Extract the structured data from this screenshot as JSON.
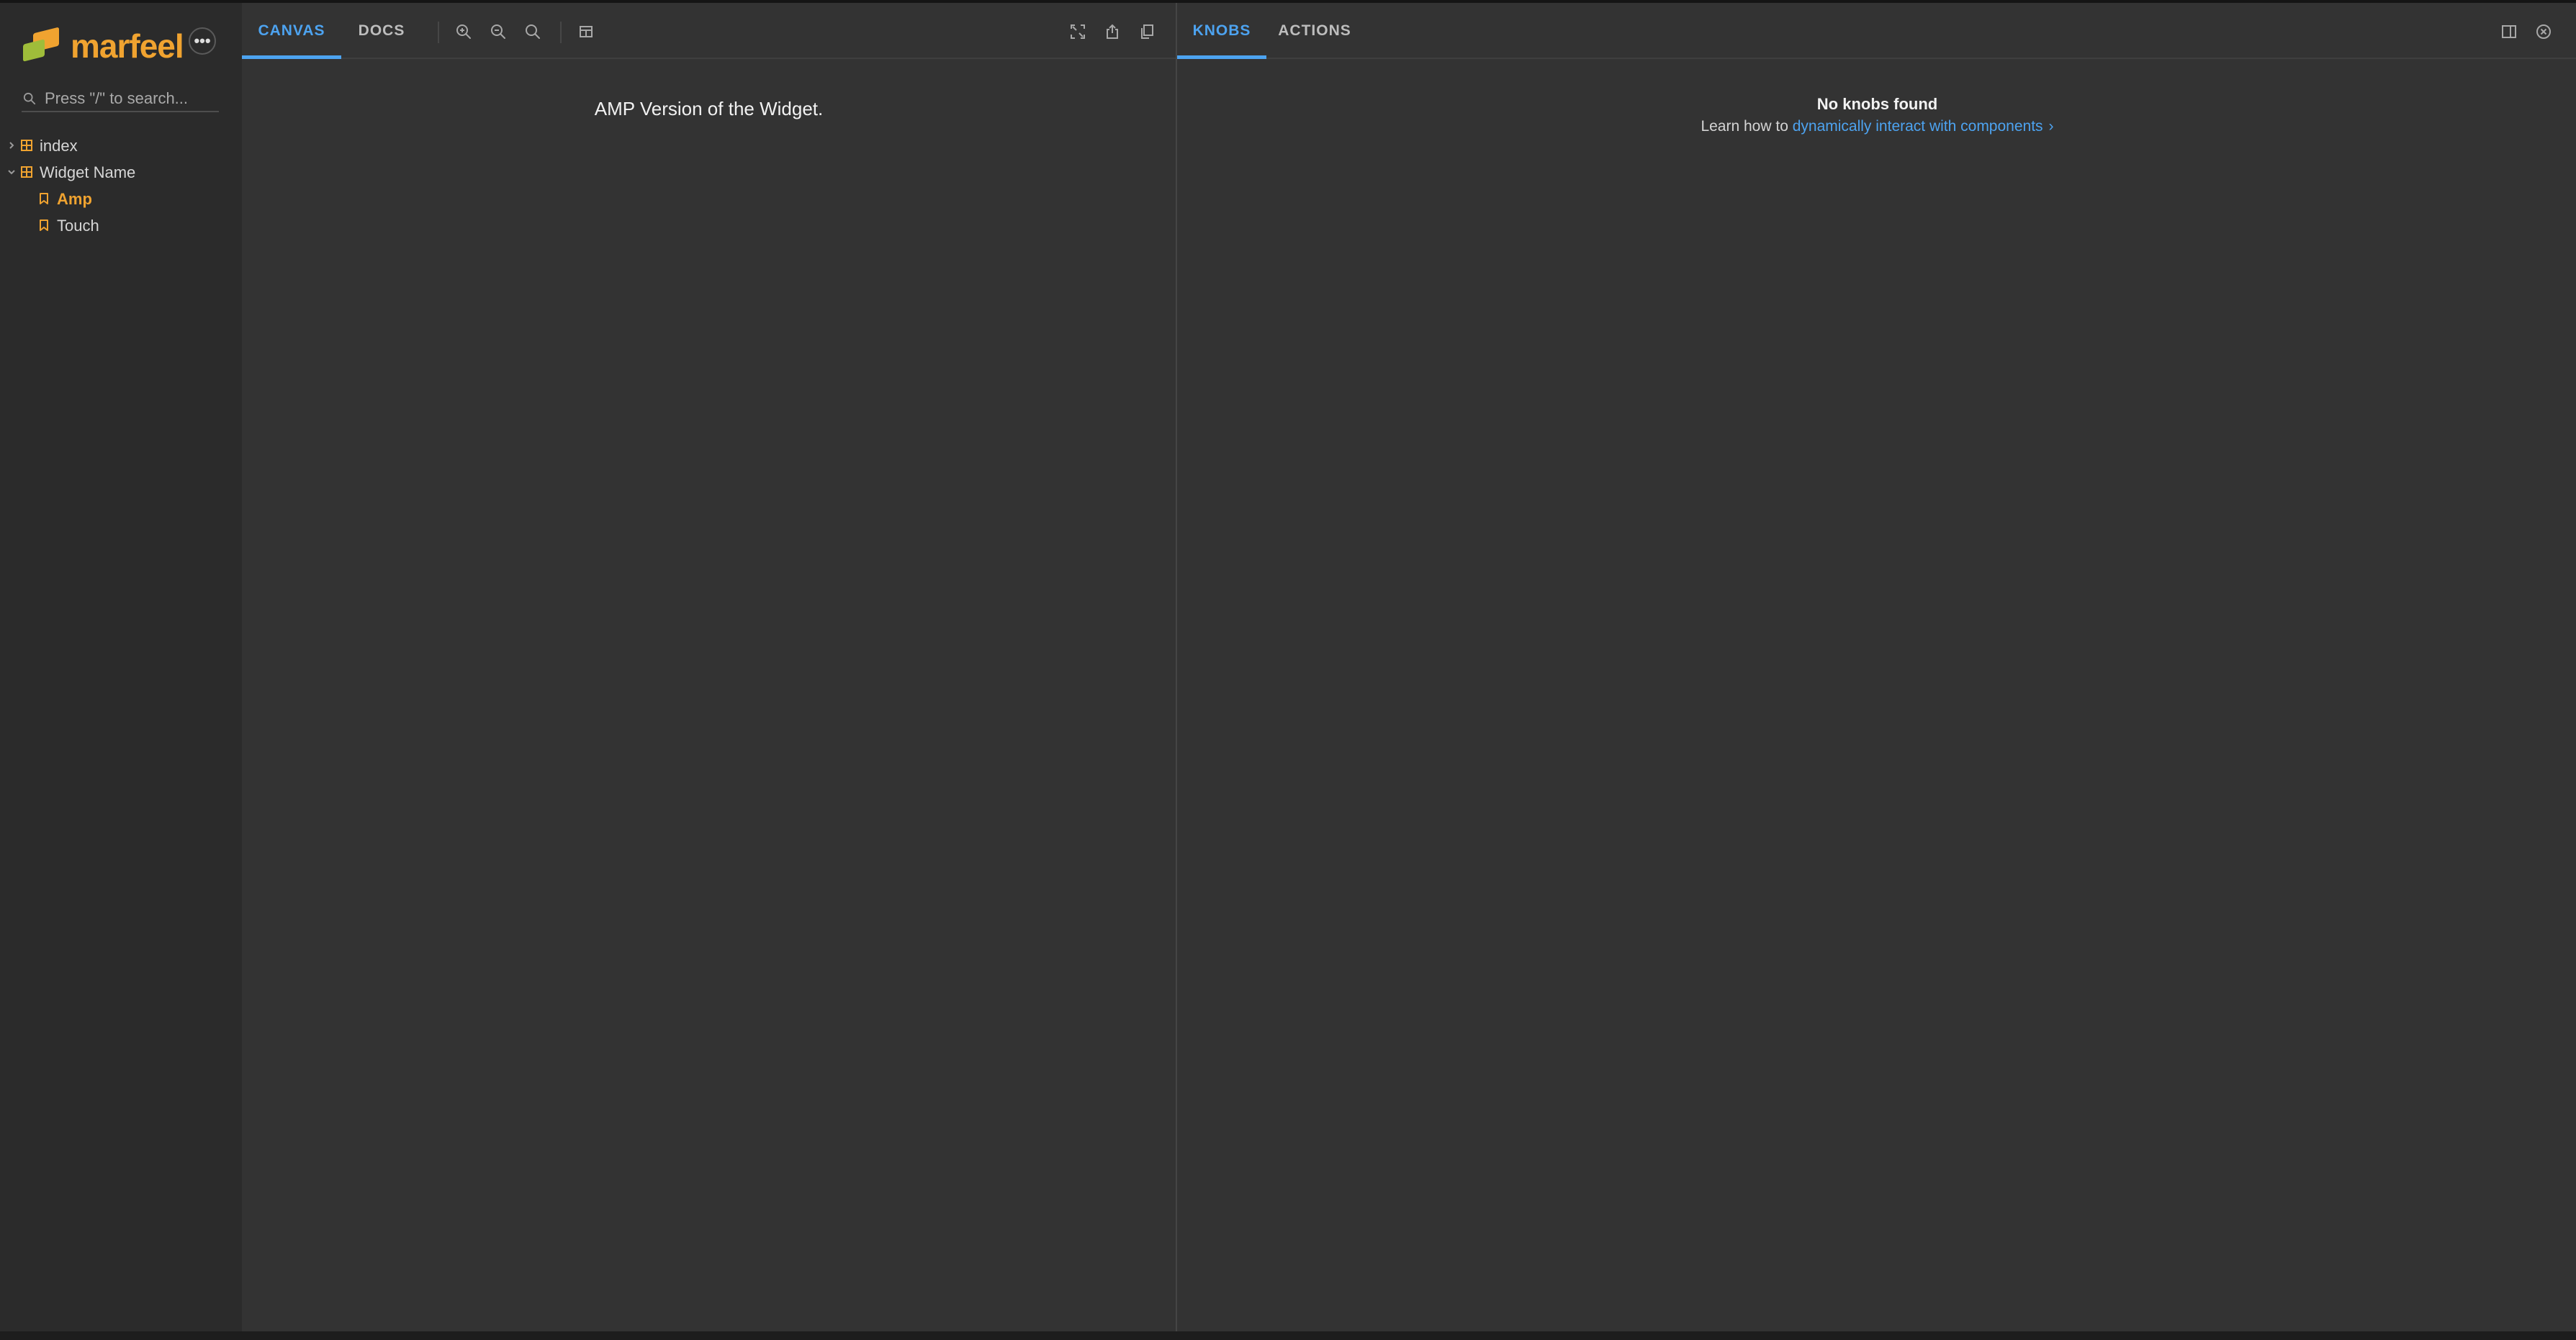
{
  "brand": {
    "name": "marfeel"
  },
  "sidebar": {
    "menu_symbol": "•••",
    "search_placeholder": "Press \"/\" to search...",
    "tree": [
      {
        "label": "index",
        "type": "component",
        "expanded": false
      },
      {
        "label": "Widget Name",
        "type": "component",
        "expanded": true
      },
      {
        "label": "Amp",
        "type": "story",
        "selected": true
      },
      {
        "label": "Touch",
        "type": "story",
        "selected": false
      }
    ]
  },
  "toolbar": {
    "tabs": [
      {
        "label": "CANVAS",
        "active": true
      },
      {
        "label": "DOCS",
        "active": false
      }
    ],
    "tools": [
      "zoom-in-icon",
      "zoom-out-icon",
      "reset-zoom-icon",
      "background-icon"
    ],
    "right_tools": [
      "fullscreen-icon",
      "share-icon",
      "copy-icon"
    ]
  },
  "canvas": {
    "content": "AMP Version of the Widget."
  },
  "addons": {
    "tabs": [
      {
        "label": "KNOBS",
        "active": true
      },
      {
        "label": "ACTIONS",
        "active": false
      }
    ],
    "tools": [
      "panel-orientation-icon",
      "close-icon"
    ],
    "empty_title": "No knobs found",
    "empty_prefix": "Learn how to ",
    "empty_link": "dynamically interact with components",
    "empty_chevron": "›"
  },
  "colors": {
    "accent": "#4da3f0",
    "brand_orange": "#f0a330",
    "brand_green": "#9fbd3a",
    "sidebar_bg": "#2b2b2b",
    "panel_bg": "#333333"
  }
}
